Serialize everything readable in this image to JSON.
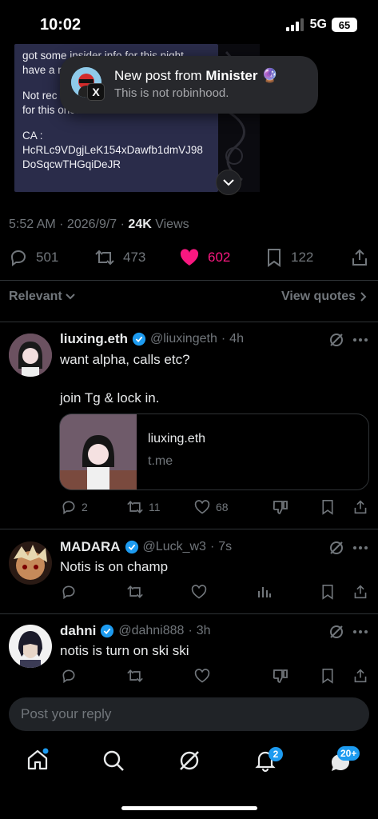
{
  "status_bar": {
    "time": "10:02",
    "network": "5G",
    "battery": "65"
  },
  "quoted_image_text": {
    "lines": [
      "got some insider info for this night",
      "have a n",
      "",
      "Not rec",
      "for this one.",
      "",
      "CA :",
      "HcRLc9VDgjLeK154xDawfb1dmVJ98",
      "DoSqcwTHGqiDeJR"
    ]
  },
  "notification": {
    "title_prefix": "New post from ",
    "author": "Minister",
    "emoji": "🔮",
    "subtitle": "This is not robinhood.",
    "app_icon": "X"
  },
  "post_meta": {
    "time": "5:52 AM",
    "date": "2026/9/7",
    "views_count": "24K",
    "views_label": "Views"
  },
  "post_actions": {
    "replies": "501",
    "reposts": "473",
    "likes": "602",
    "bookmarks": "122"
  },
  "tabs": {
    "relevant": "Relevant",
    "view_quotes": "View quotes"
  },
  "replies": [
    {
      "name": "liuxing.eth",
      "handle": "@liuxingeth",
      "time": "4h",
      "lines": [
        "want alpha, calls etc?",
        "",
        "join Tg & lock in."
      ],
      "link_card": {
        "title": "liuxing.eth",
        "domain": "t.me"
      },
      "replies": "2",
      "reposts": "11",
      "likes": "68"
    },
    {
      "name": "MADARA",
      "handle": "@Luck_w3",
      "time": "7s",
      "lines": [
        "Notis is on champ"
      ]
    },
    {
      "name": "dahni",
      "handle": "@dahni888",
      "time": "3h",
      "lines": [
        "notis is turn on ski ski"
      ]
    }
  ],
  "composer": {
    "placeholder": "Post your reply"
  },
  "nav": {
    "notifications_badge": "2",
    "messages_badge": "20+"
  },
  "colors": {
    "like": "#f91880",
    "accent": "#1d9bf0",
    "muted": "#71767b"
  },
  "icons": [
    "reply-icon",
    "repost-icon",
    "heart-icon",
    "bookmark-icon",
    "share-icon",
    "grok-icon",
    "more-icon",
    "dislike-icon",
    "analytics-icon",
    "home-icon",
    "search-icon",
    "bell-icon",
    "messages-icon"
  ]
}
